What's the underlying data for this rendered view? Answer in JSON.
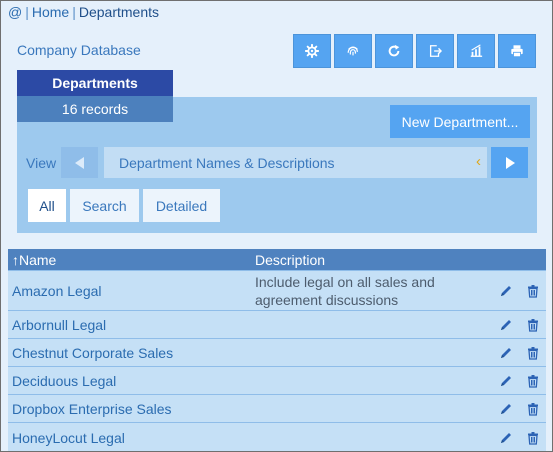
{
  "breadcrumb": {
    "at": "@",
    "sep": "|",
    "home": "Home",
    "current": "Departments"
  },
  "app_title": "Company Database",
  "toolbar": {
    "icons": [
      "gear-icon",
      "fingerprint-icon",
      "refresh-icon",
      "export-icon",
      "chart-icon",
      "print-icon"
    ]
  },
  "tab": {
    "title": "Departments",
    "records": "16 records"
  },
  "new_button": "New Department...",
  "view": {
    "label": "View",
    "selected": "Department Names & Descriptions",
    "prev_glyph": "◀",
    "next_glyph": "▶",
    "caret": "‹"
  },
  "filters": [
    "All",
    "Search",
    "Detailed"
  ],
  "active_filter": "All",
  "table": {
    "headers": {
      "name": "↑Name",
      "description": "Description"
    },
    "rows": [
      {
        "name": "Amazon Legal",
        "description": "Include legal on all sales and agreement discussions"
      },
      {
        "name": "Arbornull Legal",
        "description": ""
      },
      {
        "name": "Chestnut Corporate Sales",
        "description": ""
      },
      {
        "name": "Deciduous Legal",
        "description": ""
      },
      {
        "name": "Dropbox Enterprise Sales",
        "description": ""
      },
      {
        "name": "HoneyLocut Legal",
        "description": ""
      }
    ]
  },
  "colors": {
    "accent": "#55a4f1",
    "tab_dark": "#2c4aa5",
    "header": "#4f82bf",
    "row": "#c5e0f6",
    "panel": "#9dc9ee",
    "caret": "#e0a617"
  }
}
